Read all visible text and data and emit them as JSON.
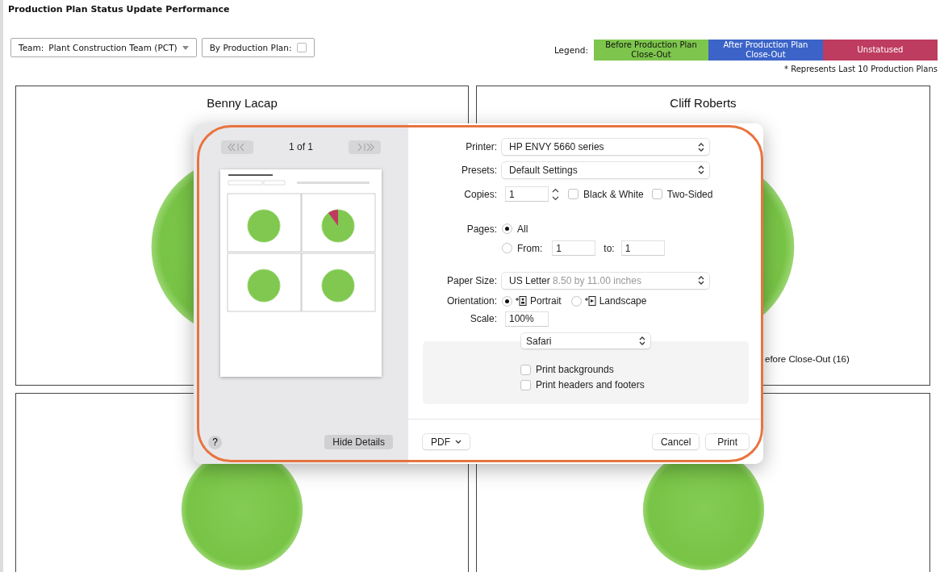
{
  "page": {
    "title": "Production Plan Status Update Performance"
  },
  "filters": {
    "team": {
      "label": "Team:",
      "value": "Plant Construction Team (PCT)"
    },
    "by_production_plan": {
      "label": "By Production Plan:",
      "checked": false
    }
  },
  "legend": {
    "label": "Legend:",
    "items": [
      {
        "text": "Before Production Plan Close-Out",
        "color": "#7dc54c"
      },
      {
        "text": "After Production Plan Close-Out",
        "color": "#3c64c8"
      },
      {
        "text": "Unstatused",
        "color": "#be3c5f"
      }
    ],
    "note": "* Represents Last 10 Production Plans"
  },
  "panels": [
    {
      "kind": "pie",
      "title": "Benny Lacap"
    },
    {
      "kind": "pie",
      "title": "Cliff Roberts",
      "slice_label": "efore Close-Out (16)"
    },
    {
      "kind": "pie"
    },
    {
      "kind": "pie"
    }
  ],
  "print_dialog": {
    "pager": "1 of 1",
    "help": "?",
    "hide_details": "Hide Details",
    "printer": {
      "label": "Printer:",
      "value": "HP ENVY 5660 series"
    },
    "presets": {
      "label": "Presets:",
      "value": "Default Settings"
    },
    "copies": {
      "label": "Copies:",
      "value": "1"
    },
    "copy_options": [
      {
        "label": "Black & White",
        "checked": false
      },
      {
        "label": "Two-Sided",
        "checked": false
      }
    ],
    "pages": {
      "label": "Pages:",
      "options": [
        {
          "kind": "all",
          "label": "All",
          "selected": true
        },
        {
          "kind": "range",
          "label": "From:",
          "selected": false,
          "from": "1",
          "to_label": "to:",
          "to": "1"
        }
      ]
    },
    "paper_size": {
      "label": "Paper Size:",
      "value": "US Letter",
      "detail": "8.50 by 11.00 inches"
    },
    "orientation": {
      "label": "Orientation:",
      "options": [
        {
          "kind": "portrait",
          "label": "Portrait",
          "selected": true
        },
        {
          "kind": "landscape",
          "label": "Landscape",
          "selected": false
        }
      ]
    },
    "scale": {
      "label": "Scale:",
      "value": "100%"
    },
    "app_menu": "Safari",
    "app_options": [
      {
        "label": "Print backgrounds",
        "checked": false
      },
      {
        "label": "Print headers and footers",
        "checked": false
      }
    ],
    "pdf": "PDF",
    "cancel": "Cancel",
    "print": "Print"
  }
}
